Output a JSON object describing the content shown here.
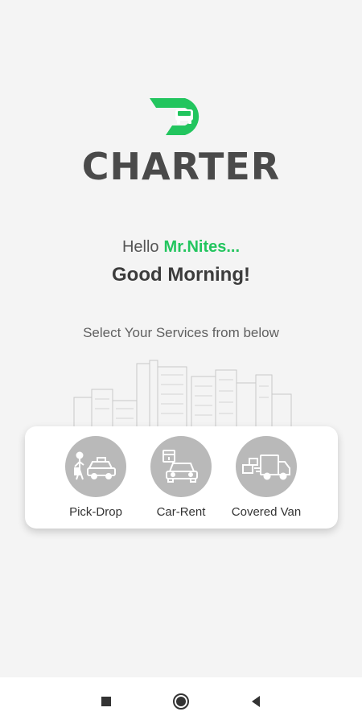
{
  "app": {
    "logo_text": "CHARTER"
  },
  "greeting": {
    "hello": "Hello",
    "name": "Mr.Nites...",
    "message": "Good Morning!",
    "subtitle": "Select Your Services from below"
  },
  "services": [
    {
      "label": "Pick-Drop",
      "icon": "pick-drop-icon"
    },
    {
      "label": "Car-Rent",
      "icon": "car-rent-icon"
    },
    {
      "label": "Covered Van",
      "icon": "covered-van-icon"
    }
  ],
  "colors": {
    "accent": "#22c55e",
    "logo_text": "#4a4a4a",
    "icon_circle": "#b9b9b9",
    "background": "#f4f4f4"
  },
  "navbar": {
    "recent": "square-icon",
    "home": "circle-icon",
    "back": "triangle-back-icon"
  }
}
